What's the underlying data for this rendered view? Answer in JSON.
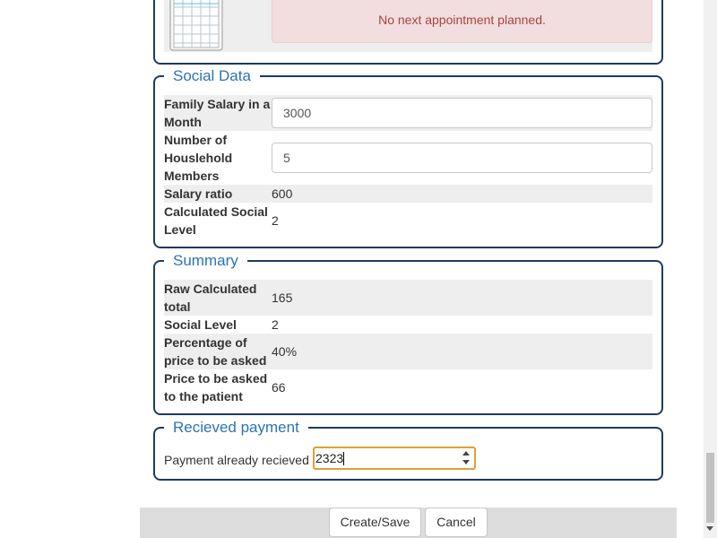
{
  "appointment": {
    "message": "No next appointment planned.",
    "icon": "calendar-icon"
  },
  "social_data": {
    "legend": "Social Data",
    "family_salary_label": "Family Salary in a Month",
    "family_salary_value": "3000",
    "household_label": "Number of Houslehold Members",
    "household_value": "5",
    "salary_ratio_label": "Salary ratio",
    "salary_ratio_value": "600",
    "social_level_label": "Calculated Social Level",
    "social_level_value": "2"
  },
  "summary": {
    "legend": "Summary",
    "rows": [
      {
        "label": "Raw Calculated total",
        "value": "165"
      },
      {
        "label": "Social Level",
        "value": "2"
      },
      {
        "label": "Percentage of price to be asked",
        "value": "40%"
      },
      {
        "label": "Price to be asked to the patient",
        "value": "66"
      }
    ]
  },
  "payment": {
    "legend": "Recieved payment",
    "label": "Payment already recieved",
    "value": "2323"
  },
  "actions": {
    "save_label": "Create/Save",
    "cancel_label": "Cancel"
  },
  "colors": {
    "legend": "#2a74b6",
    "border": "#1f3a5f",
    "alert_bg": "#f2dede",
    "alert_text": "#a94442",
    "focus": "#e0a030"
  }
}
